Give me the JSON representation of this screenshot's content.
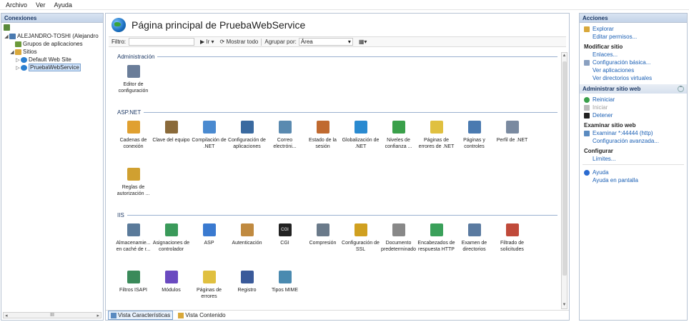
{
  "menu": [
    "Archivo",
    "Ver",
    "Ayuda"
  ],
  "left": {
    "title": "Conexiones",
    "tree": [
      {
        "label": "ALEJANDRO-TOSHI (Alejandro",
        "level": 0,
        "exp": "◢",
        "icon": "computer-icon",
        "color": "#4a7ab0"
      },
      {
        "label": "Grupos de aplicaciones",
        "level": 1,
        "exp": "",
        "icon": "app-pool-icon",
        "color": "#6b9a3a"
      },
      {
        "label": "Sitios",
        "level": 1,
        "exp": "◢",
        "icon": "sites-folder-icon",
        "color": "#d9a83a"
      },
      {
        "label": "Default Web Site",
        "level": 2,
        "exp": "▷",
        "icon": "site-globe-icon",
        "color": "#2a7fd0"
      },
      {
        "label": "PruebaWebService",
        "level": 2,
        "exp": "▷",
        "icon": "site-globe-icon",
        "color": "#2a7fd0",
        "selected": true
      }
    ],
    "scroll_mid": "III"
  },
  "center": {
    "title": "Página principal de PruebaWebService",
    "filter_label": "Filtro:",
    "filter_value": "",
    "go_label": "Ir",
    "show_all_label": "Mostrar todo",
    "group_by_label": "Agrupar por:",
    "group_by_value": "Área",
    "sections": [
      {
        "name": "Administración",
        "items": [
          {
            "label": "Editor de configuración",
            "icon": "config-editor-icon",
            "color": "#6a7d99"
          }
        ]
      },
      {
        "name": "ASP.NET",
        "items": [
          {
            "label": "Cadenas de conexión",
            "icon": "connection-strings-icon",
            "color": "#e0a030"
          },
          {
            "label": "Clave del equipo",
            "icon": "machine-key-icon",
            "color": "#8a6a3a"
          },
          {
            "label": "Compilación de .NET",
            "icon": "dotnet-compilation-icon",
            "color": "#4a8ad0"
          },
          {
            "label": "Configuración de aplicaciones",
            "icon": "app-settings-icon",
            "color": "#3a6aa0"
          },
          {
            "label": "Correo electróni...",
            "icon": "smtp-email-icon",
            "color": "#5a8ab0"
          },
          {
            "label": "Estado de la sesión",
            "icon": "session-state-icon",
            "color": "#c06a30"
          },
          {
            "label": "Globalización de .NET",
            "icon": "globalization-icon",
            "color": "#2a8ad0"
          },
          {
            "label": "Niveles de confianza ...",
            "icon": "trust-levels-icon",
            "color": "#3aa04a"
          },
          {
            "label": "Páginas de errores de .NET",
            "icon": "error-pages-net-icon",
            "color": "#e0c040"
          },
          {
            "label": "Páginas y controles",
            "icon": "pages-controls-icon",
            "color": "#4a7ab0"
          },
          {
            "label": "Perfil de .NET",
            "icon": "net-profile-icon",
            "color": "#7a8aa0"
          },
          {
            "label": "Reglas de autorización ...",
            "icon": "authorization-rules-icon",
            "color": "#d0a030"
          }
        ]
      },
      {
        "name": "IIS",
        "items": [
          {
            "label": "Almacenamie... en caché de r...",
            "icon": "output-caching-icon",
            "color": "#5a7a9a"
          },
          {
            "label": "Asignaciones de controlador",
            "icon": "handler-mappings-icon",
            "color": "#3a9a5a"
          },
          {
            "label": "ASP",
            "icon": "asp-icon",
            "color": "#3a7ad0"
          },
          {
            "label": "Autenticación",
            "icon": "authentication-icon",
            "color": "#c08a40"
          },
          {
            "label": "CGI",
            "icon": "cgi-icon",
            "color": "#222222"
          },
          {
            "label": "Compresión",
            "icon": "compression-icon",
            "color": "#6a7a8a"
          },
          {
            "label": "Configuración de SSL",
            "icon": "ssl-lock-icon",
            "color": "#d0a020"
          },
          {
            "label": "Documento predeterminado",
            "icon": "default-document-icon",
            "color": "#888888"
          },
          {
            "label": "Encabezados de respuesta HTTP",
            "icon": "http-headers-icon",
            "color": "#3aa05a"
          },
          {
            "label": "Examen de directorios",
            "icon": "directory-browsing-icon",
            "color": "#5a7aa0"
          },
          {
            "label": "Filtrado de solicitudes",
            "icon": "request-filtering-icon",
            "color": "#c04a3a"
          },
          {
            "label": "Filtros ISAPI",
            "icon": "isapi-filters-icon",
            "color": "#3a8a5a"
          },
          {
            "label": "Módulos",
            "icon": "modules-icon",
            "color": "#6a4ac0"
          },
          {
            "label": "Páginas de errores",
            "icon": "error-pages-icon",
            "color": "#e0c040"
          },
          {
            "label": "Registro",
            "icon": "logging-icon",
            "color": "#3a5a9a"
          },
          {
            "label": "Tipos MIME",
            "icon": "mime-types-icon",
            "color": "#4a8ab0"
          }
        ]
      }
    ],
    "tabs": [
      {
        "label": "Vista Características",
        "active": true
      },
      {
        "label": "Vista Contenido",
        "active": false
      }
    ]
  },
  "right": {
    "title": "Acciones",
    "groups": [
      {
        "items": [
          {
            "label": "Explorar",
            "kind": "link",
            "icon": "explore-folder-icon",
            "color": "#d9a83a"
          },
          {
            "label": "Editar permisos...",
            "kind": "link",
            "indent": true
          },
          {
            "label": "Modificar sitio",
            "kind": "header"
          },
          {
            "label": "Enlaces...",
            "kind": "link",
            "indent": true
          },
          {
            "label": "Configuración básica...",
            "kind": "link",
            "icon": "basic-settings-icon",
            "color": "#8aa0c0"
          },
          {
            "label": "Ver aplicaciones",
            "kind": "link",
            "indent": true
          },
          {
            "label": "Ver directorios virtuales",
            "kind": "link",
            "indent": true
          }
        ]
      },
      {
        "subheader": "Administrar sitio web",
        "items": [
          {
            "label": "Reiniciar",
            "kind": "link",
            "icon": "restart-icon",
            "color": "#3aa04a"
          },
          {
            "label": "Iniciar",
            "kind": "disabled",
            "icon": "start-icon",
            "color": "#bbbbbb"
          },
          {
            "label": "Detener",
            "kind": "link",
            "icon": "stop-icon",
            "color": "#222222"
          },
          {
            "label": "Examinar sitio web",
            "kind": "header"
          },
          {
            "label": "Examinar *:44444 (http)",
            "kind": "link",
            "icon": "browse-icon",
            "color": "#5a8ac0"
          },
          {
            "label": "Configuración avanzada...",
            "kind": "link",
            "indent": true
          },
          {
            "label": "Configurar",
            "kind": "header"
          },
          {
            "label": "Límites...",
            "kind": "link",
            "indent": true
          }
        ]
      },
      {
        "items": [
          {
            "label": "Ayuda",
            "kind": "link",
            "icon": "help-icon",
            "color": "#2a6ad0"
          },
          {
            "label": "Ayuda en pantalla",
            "kind": "link",
            "indent": true
          }
        ]
      }
    ]
  }
}
